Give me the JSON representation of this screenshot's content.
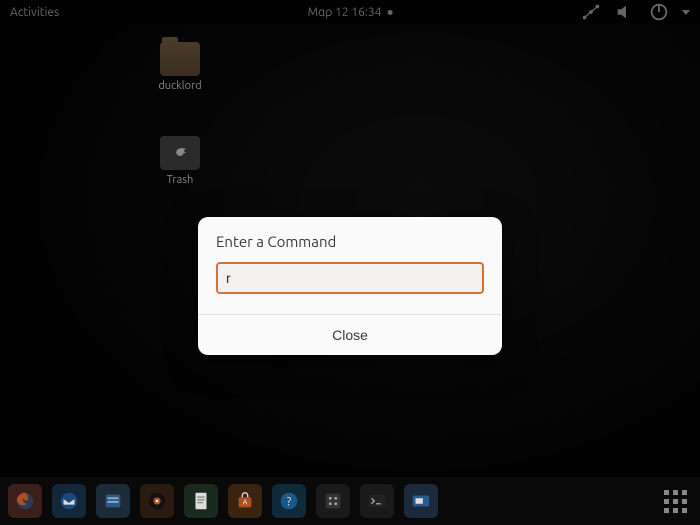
{
  "topbar": {
    "activities_label": "Activities",
    "datetime": "Μαρ 12  16:34"
  },
  "desktop_icons": {
    "folder_label": "ducklord",
    "trash_label": "Trash"
  },
  "dialog": {
    "title": "Enter a Command",
    "input_value": "r",
    "close_label": "Close"
  },
  "dock": {
    "items": [
      {
        "name": "firefox",
        "color": "#3a1f1a"
      },
      {
        "name": "thunderbird",
        "color": "#12283a"
      },
      {
        "name": "files",
        "color": "#1c2b3a"
      },
      {
        "name": "rhythmbox",
        "color": "#2a1a10"
      },
      {
        "name": "writer",
        "color": "#1a2a1f"
      },
      {
        "name": "software",
        "color": "#3a2410"
      },
      {
        "name": "help",
        "color": "#102a3a"
      },
      {
        "name": "settings",
        "color": "#1a1a1a"
      },
      {
        "name": "terminal",
        "color": "#1a1a1a"
      },
      {
        "name": "screenshot",
        "color": "#1a2a3a"
      }
    ]
  },
  "colors": {
    "accent": "#d6713a"
  }
}
